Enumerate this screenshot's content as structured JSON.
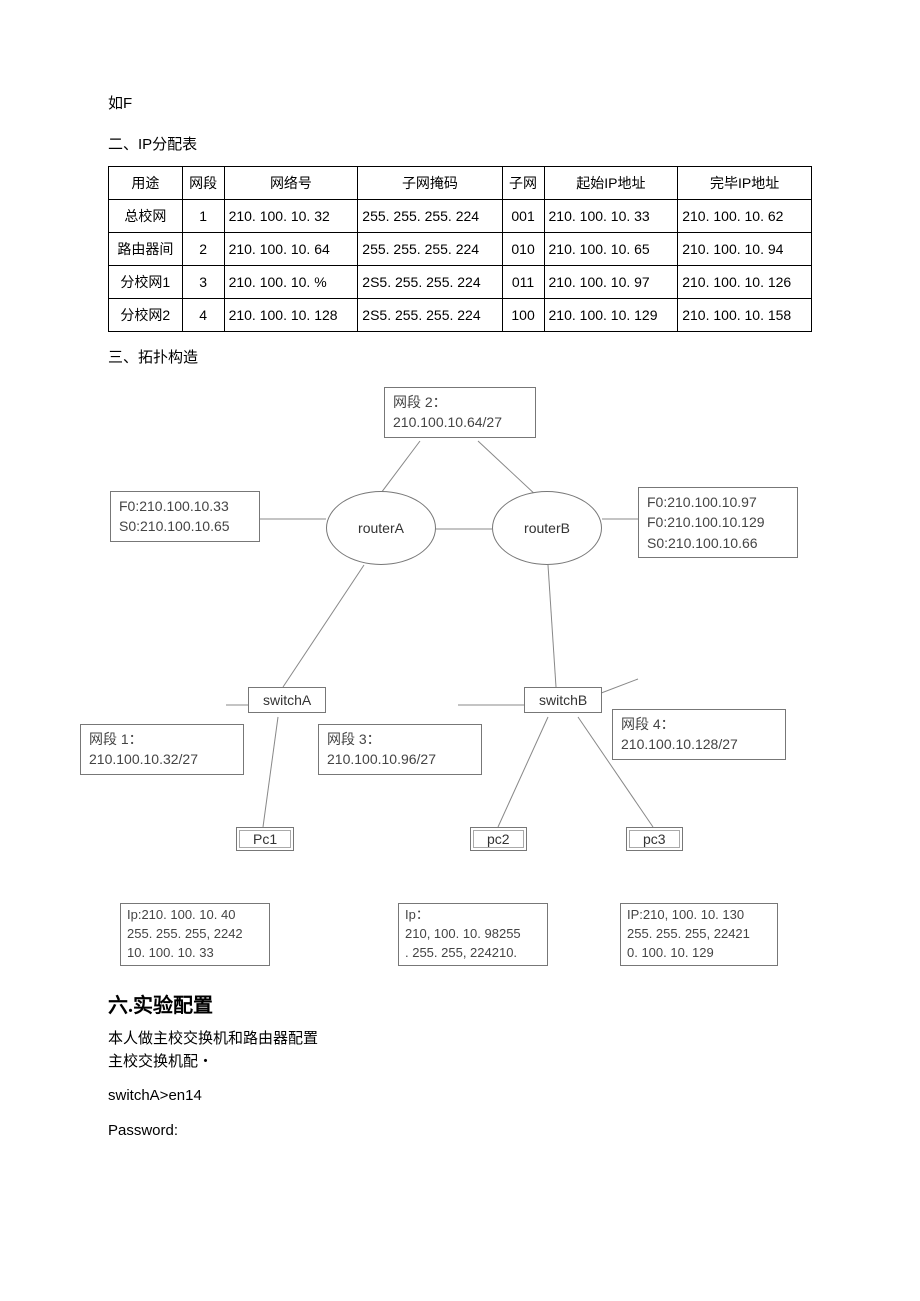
{
  "intro_line": "如F",
  "sec2_title": "二、IP分配表",
  "table": {
    "headers": [
      "用途",
      "网段",
      "网络号",
      "子网掩码",
      "子网",
      "起始IP地址",
      "完毕IP地址"
    ],
    "rows": [
      [
        "总校网",
        "1",
        "210. 100. 10. 32",
        "255. 255. 255. 224",
        "001",
        "210. 100. 10. 33",
        "210. 100. 10. 62"
      ],
      [
        "路由器间",
        "2",
        "210. 100. 10. 64",
        "255. 255. 255. 224",
        "010",
        "210. 100. 10. 65",
        "210. 100. 10. 94"
      ],
      [
        "分校网1",
        "3",
        "210. 100. 10. %",
        "2S5. 255. 255. 224",
        "011",
        "210. 100. 10. 97",
        "210. 100. 10. 126"
      ],
      [
        "分校网2",
        "4",
        "210. 100. 10. 128",
        "2S5. 255. 255. 224",
        "100",
        "210. 100. 10. 129",
        "210. 100. 10. 158"
      ]
    ]
  },
  "sec3_title": "三、拓扑构造",
  "diagram": {
    "seg2": {
      "l1": "网段 2：",
      "l2": "210.100.10.64/27"
    },
    "routerA_box": {
      "l1": "F0:210.100.10.33",
      "l2": "S0:210.100.10.65"
    },
    "routerB_box": {
      "l1": "F0:210.100.10.97",
      "l2": "F0:210.100.10.129",
      "l3": "S0:210.100.10.66"
    },
    "routerA": "routerA",
    "routerB": "routerB",
    "switchA": "switchA",
    "switchB": "switchB",
    "seg1": {
      "l1": "网段 1：",
      "l2": "210.100.10.32/27"
    },
    "seg3": {
      "l1": "网段 3：",
      "l2": "210.100.10.96/27"
    },
    "seg4": {
      "l1": "网段 4：",
      "l2": "210.100.10.128/27"
    },
    "pc1": "Pc1",
    "pc2": "pc2",
    "pc3": "pc3",
    "pc1_box": {
      "l1": "Ip:210. 100. 10. 40",
      "l2": "255. 255. 255, 2242",
      "l3": "10. 100. 10. 33"
    },
    "pc2_box": {
      "l1": "Ip：",
      "l2": "210, 100. 10. 98255",
      "l3": ". 255. 255, 224210."
    },
    "pc3_box": {
      "l1": "IP:210, 100. 10. 130",
      "l2": "255. 255. 255, 22421",
      "l3": "0. 100. 10. 129"
    }
  },
  "sec6_title": "六.实验配置",
  "cfg_line1": "本人做主校交换机和路由器配置",
  "cfg_line2": "主校交换机配・",
  "cfg_cmd1": "switchA>en14",
  "cfg_cmd2": "Password:"
}
